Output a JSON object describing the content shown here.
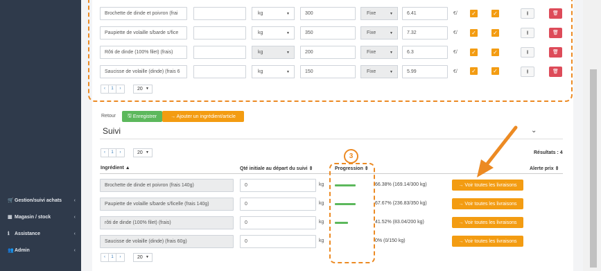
{
  "sidebar": {
    "items": [
      {
        "icon": "cart-icon",
        "glyph": "🛒",
        "label": "Gestion/suivi achats"
      },
      {
        "icon": "cubes-icon",
        "glyph": "▦",
        "label": "Magasin / stock"
      },
      {
        "icon": "info-icon",
        "glyph": "ℹ",
        "label": "Assistance"
      },
      {
        "icon": "users-icon",
        "glyph": "👥",
        "label": "Admin"
      }
    ]
  },
  "ingredients_table": {
    "rows": [
      {
        "name": "Brochette de dinde et poivron (frai",
        "unit": "kg",
        "qty": "300",
        "mode": "Fixe",
        "price": "6.41",
        "currency": "€/"
      },
      {
        "name": "Paupiette de volaille s/barde s/fice",
        "unit": "kg",
        "qty": "350",
        "mode": "Fixe",
        "price": "7.32",
        "currency": "€/"
      },
      {
        "name": "Rôti de dinde (100% filet) (frais)",
        "unit": "kg",
        "qty": "200",
        "mode": "Fixe",
        "price": "6.3",
        "currency": "€/"
      },
      {
        "name": "Saucisse de volaille (dinde) (frais 6",
        "unit": "kg",
        "qty": "150",
        "mode": "Fixe",
        "price": "5.99",
        "currency": "€/"
      }
    ],
    "pagination": {
      "prev": "‹",
      "page": "1",
      "next": "›",
      "page_size": "20"
    }
  },
  "actions": {
    "retour": "Retour",
    "enregistrer": "Enregistrer",
    "ajouter": "→ Ajouter un ingrédient/article"
  },
  "suivi": {
    "title": "Suivi",
    "pagination": {
      "prev": "‹",
      "page": "1",
      "next": "›",
      "page_size": "20"
    },
    "results": "Résultats : 4",
    "headers": {
      "ingredient": "Ingrédient ▲",
      "qty": "Qté initiale au départ du suivi ⇕",
      "progress": "Progression ⇕",
      "alert": "Alerte prix ⇕"
    },
    "rows": [
      {
        "name": "Brochette de dinde et poivron (frais 140g)",
        "qty": "0",
        "unit": "kg",
        "progress": 0.6638,
        "progress_text": "66.38% (169.14/300 kg)",
        "button": "→ Voir toutes les livraisons"
      },
      {
        "name": "Paupiette de volaille s/barde s/ficelle (frais 140g)",
        "qty": "0",
        "unit": "kg",
        "progress": 0.6767,
        "progress_text": "67.67% (236.83/350 kg)",
        "button": "→ Voir toutes les livraisons"
      },
      {
        "name": "rôti de dinde (100% filet) (frais)",
        "qty": "0",
        "unit": "kg",
        "progress": 0.4152,
        "progress_text": "41.52% (83.04/200 kg)",
        "button": "→ Voir toutes les livraisons"
      },
      {
        "name": "Saucisse de volaille (dinde) (frais 60g)",
        "qty": "0",
        "unit": "kg",
        "progress": 0,
        "progress_text": "0% (0/150 kg)",
        "button": "→ Voir toutes les livraisons"
      }
    ]
  },
  "annotation": {
    "number": "3"
  },
  "colors": {
    "accent": "#ec8a23",
    "sidebar": "#2f3a4b",
    "success": "#5cb85c",
    "danger": "#dd4b59",
    "orange_button": "#f39c12"
  }
}
